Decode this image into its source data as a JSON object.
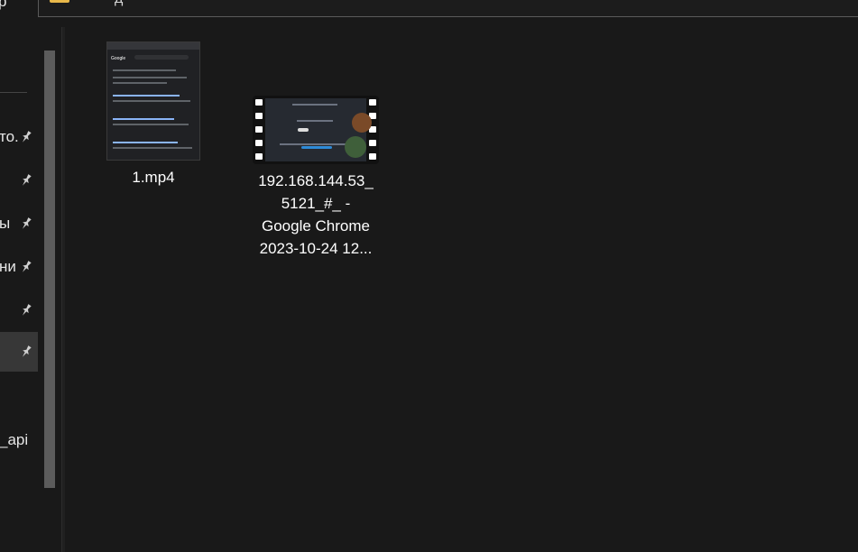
{
  "address_bar": {
    "left_cut_text": "р",
    "crumb_text": "д"
  },
  "nav": {
    "items": [
      {
        "label": "то.",
        "pinned": true,
        "selected": false
      },
      {
        "label": "",
        "pinned": true,
        "selected": false
      },
      {
        "label": "ы",
        "pinned": true,
        "selected": false
      },
      {
        "label": "ни",
        "pinned": true,
        "selected": false
      },
      {
        "label": "",
        "pinned": true,
        "selected": false
      },
      {
        "label": "",
        "pinned": true,
        "selected": true
      },
      {
        "label": "_api",
        "pinned": false,
        "selected": false
      }
    ]
  },
  "files": [
    {
      "name": "1.mp4",
      "thumb": "browser-screenshot-video-thumbnail"
    },
    {
      "name": "192.168.144.53_\n5121_#_ -\nGoogle Chrome\n2023-10-24 12...",
      "thumb": "video-filmstrip-thumbnail"
    }
  ],
  "colors": {
    "background": "#191919",
    "selected": "#373737",
    "folder": "#e8b84a",
    "text": "#ffffff"
  }
}
